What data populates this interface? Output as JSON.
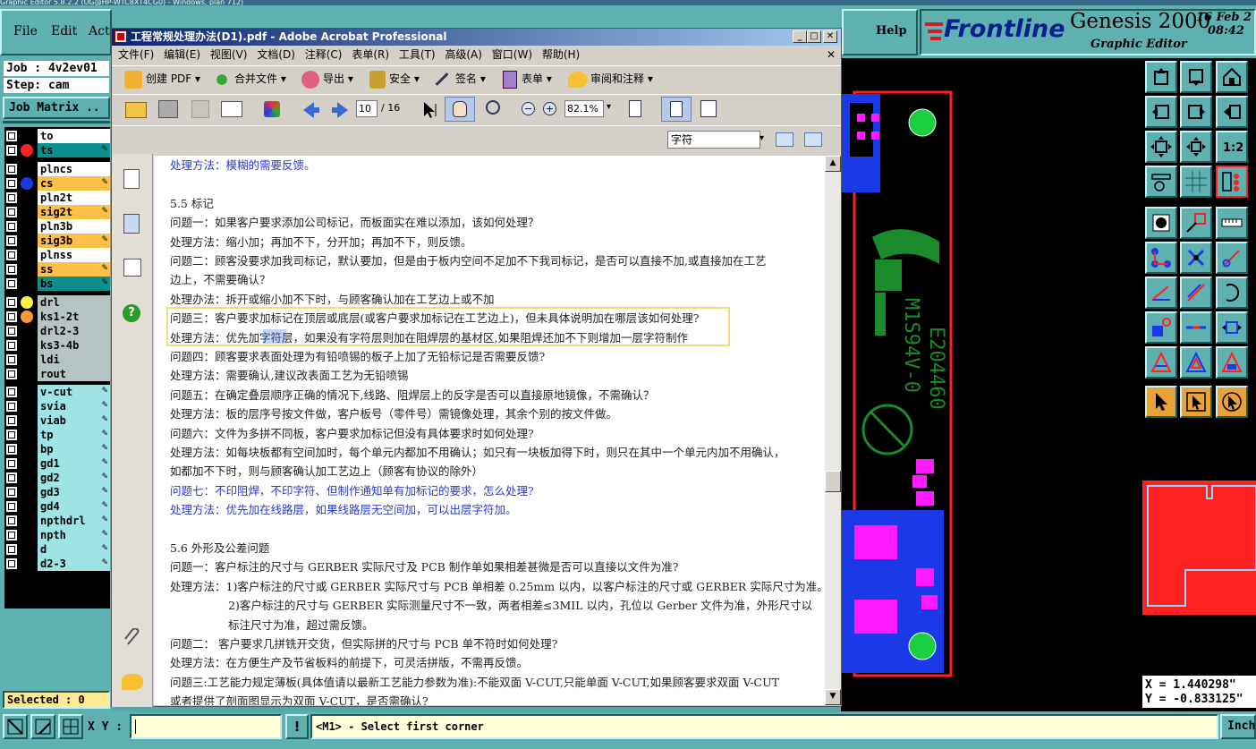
{
  "genesis": {
    "title_strip": "Graphic Editor 5.8.2.2 (UG@HP-WTC8XT4CG0) - Windows, plan 712)",
    "menu": [
      "File",
      "Edit",
      "Act"
    ],
    "help": "Help",
    "brand": "Frontline",
    "product": "Genesis 2000",
    "subtitle": "Graphic Editor",
    "date": "16 Feb 2",
    "time": "08:42",
    "job": "Job : 4v2ev01",
    "step": "Step: cam",
    "job_matrix": "Job Matrix ..",
    "selected": "Selected : 0",
    "xy_label": "X Y :",
    "prompt": "<M1> - Select first corner",
    "units": "Inch",
    "coord_x": "X = 1.440298\"",
    "coord_y": "Y = -0.833125\"",
    "board_text_1": "E204460",
    "board_text_2": "M1S94V-0",
    "colors": {
      "panel": "#5fb0b0",
      "dark": "#1f5a5a",
      "orange": "#e8a23a",
      "board_red": "#ff2020",
      "board_green": "#1a8a2a",
      "pad_magenta": "#ff1aff",
      "copper_blue": "#1a3ae8"
    }
  },
  "layers": [
    {
      "name": "to",
      "dot": "",
      "style": "plain",
      "edit": false
    },
    {
      "name": "ts",
      "dot": "#ff2020",
      "style": "teal",
      "edit": true
    },
    {
      "name": "plncs",
      "dot": "",
      "style": "plain",
      "edit": false
    },
    {
      "name": "cs",
      "dot": "#1a3ae8",
      "style": "orange",
      "edit": true
    },
    {
      "name": "pln2t",
      "dot": "",
      "style": "plain",
      "edit": false
    },
    {
      "name": "sig2t",
      "dot": "",
      "style": "orange",
      "edit": true
    },
    {
      "name": "pln3b",
      "dot": "",
      "style": "plain",
      "edit": false
    },
    {
      "name": "sig3b",
      "dot": "",
      "style": "orange",
      "edit": true
    },
    {
      "name": "plnss",
      "dot": "",
      "style": "plain",
      "edit": false
    },
    {
      "name": "ss",
      "dot": "",
      "style": "orange",
      "edit": true
    },
    {
      "name": "bs",
      "dot": "",
      "style": "teal",
      "edit": true
    },
    {
      "name": "drl",
      "dot": "#ffee44",
      "style": "grey",
      "edit": false
    },
    {
      "name": "ks1-2t",
      "dot": "#ff9933",
      "style": "grey",
      "edit": false
    },
    {
      "name": "drl2-3",
      "dot": "",
      "style": "grey",
      "edit": false
    },
    {
      "name": "ks3-4b",
      "dot": "",
      "style": "grey",
      "edit": false
    },
    {
      "name": "ldi",
      "dot": "",
      "style": "grey",
      "edit": false
    },
    {
      "name": "rout",
      "dot": "",
      "style": "grey",
      "edit": false
    },
    {
      "name": "v-cut",
      "dot": "",
      "style": "cyan",
      "edit": true
    },
    {
      "name": "svia",
      "dot": "",
      "style": "cyan",
      "edit": true
    },
    {
      "name": "viab",
      "dot": "",
      "style": "cyan",
      "edit": true
    },
    {
      "name": "tp",
      "dot": "",
      "style": "cyan",
      "edit": true
    },
    {
      "name": "bp",
      "dot": "",
      "style": "cyan",
      "edit": true
    },
    {
      "name": "gd1",
      "dot": "",
      "style": "cyan",
      "edit": true
    },
    {
      "name": "gd2",
      "dot": "",
      "style": "cyan",
      "edit": true
    },
    {
      "name": "gd3",
      "dot": "",
      "style": "cyan",
      "edit": true
    },
    {
      "name": "gd4",
      "dot": "",
      "style": "cyan",
      "edit": true
    },
    {
      "name": "npthdrl",
      "dot": "",
      "style": "cyan",
      "edit": true
    },
    {
      "name": "npth",
      "dot": "",
      "style": "cyan",
      "edit": true
    },
    {
      "name": "d",
      "dot": "",
      "style": "cyan",
      "edit": true
    },
    {
      "name": "d2-3",
      "dot": "",
      "style": "cyan",
      "edit": true
    }
  ],
  "acrobat": {
    "title": "工程常规处理办法(D1).pdf - Adobe Acrobat Professional",
    "menu": [
      "文件(F)",
      "编辑(E)",
      "视图(V)",
      "文档(D)",
      "注释(C)",
      "表单(R)",
      "工具(T)",
      "高级(A)",
      "窗口(W)",
      "帮助(H)"
    ],
    "toolbar1": {
      "create_pdf": "创建 PDF",
      "merge": "合并文件",
      "export": "导出",
      "security": "安全",
      "sign": "签名",
      "forms": "表单",
      "review": "审阅和注释"
    },
    "page_current": "10",
    "page_total": "/ 16",
    "zoom": "82.1%",
    "search_value": "字符",
    "lines": [
      {
        "text": "处理方法：模糊的需要反馈。",
        "cls": "blue"
      },
      {
        "text": "",
        "cls": ""
      },
      {
        "text": "5.5 标记",
        "cls": ""
      },
      {
        "text": "问题一：如果客户要求添加公司标记，而板面实在难以添加，该如何处理？",
        "cls": ""
      },
      {
        "text": "处理方法：缩小加；再加不下，分开加；再加不下，则反馈。",
        "cls": ""
      },
      {
        "text": "问题二：顾客没要求加我司标记，默认要加，但是由于板内空间不足加不下我司标记，是否可以直接不加,或直接加在工艺",
        "cls": ""
      },
      {
        "text": "边上，不需要确认？",
        "cls": ""
      },
      {
        "text": "处理办法：拆开或缩小加不下时，与顾客确认加在工艺边上或不加",
        "cls": ""
      },
      {
        "text": "问题三：客户要求加标记在顶层或底层(或客户要求加标记在工艺边上)，但未具体说明加在哪层该如何处理?",
        "cls": "hl1"
      },
      {
        "text": "处理方法：优先加字符层，如果没有字符层则加在阻焊层的基材区,如果阻焊还加不下则增加一层字符制作",
        "cls": "hl2"
      },
      {
        "text": "问题四：顾客要求表面处理为有铅喷锡的板子上加了无铅标记是否需要反馈?",
        "cls": ""
      },
      {
        "text": "处理方法：需要确认,建议改表面工艺为无铅喷锡",
        "cls": ""
      },
      {
        "text": "问题五：在确定叠层顺序正确的情况下,线路、阻焊层上的反字是否可以直接原地镜像，不需确认？",
        "cls": ""
      },
      {
        "text": "处理方法：板的层序号按文件做，客户板号（零件号）需镜像处理，其余个别的按文件做。",
        "cls": ""
      },
      {
        "text": "问题六：文件为多拼不同板，客户要求加标记但没有具体要求时如何处理?",
        "cls": ""
      },
      {
        "text": "处理方法：如每块板都有空间加时，每个单元内都加不用确认；如只有一块板加得下时，则只在其中一个单元内加不用确认，",
        "cls": ""
      },
      {
        "text": "如都加不下时，则与顾客确认加工艺边上（顾客有协议的除外）",
        "cls": ""
      },
      {
        "text": "问题七：不印阻焊，不印字符、但制作通知单有加标记的要求，怎么处理?",
        "cls": "blue"
      },
      {
        "text": "处理方法：优先加在线路层，如果线路层无空间加，可以出层字符加。",
        "cls": "blue"
      },
      {
        "text": "",
        "cls": ""
      },
      {
        "text": "5.6 外形及公差问题",
        "cls": ""
      },
      {
        "text": "问题一：客户标注的尺寸与 GERBER 实际尺寸及 PCB 制作单如果相差甚微是否可以直接以文件为准?",
        "cls": ""
      },
      {
        "text": "处理方法：1)客户标注的尺寸或 GERBER 实际尺寸与 PCB 单相差 0.25mm 以内，以客户标注的尺寸或 GERBER 实际尺寸为准。",
        "cls": ""
      },
      {
        "text": "2)客户标注的尺寸与 GERBER 实际测量尺寸不一致，两者相差≤3MIL 以内，孔位以 Gerber 文件为准，外形尺寸以",
        "cls": "indent"
      },
      {
        "text": "标注尺寸为准，超过需反馈。",
        "cls": "indent"
      },
      {
        "text": "问题二：  客户要求几拼铣开交货，但实际拼的尺寸与 PCB 单不符时如何处理?",
        "cls": ""
      },
      {
        "text": "处理方法：在方便生产及节省板料的前提下，可灵活拼版，不需再反馈。",
        "cls": ""
      },
      {
        "text": "问题三:工艺能力规定薄板(具体值请以最新工艺能力参数为准):不能双面 V-CUT,只能单面 V-CUT,如果顾客要求双面 V-CUT",
        "cls": ""
      },
      {
        "text": "或者提供了剖面图显示为双面 V-CUT，是否需确认?",
        "cls": ""
      }
    ]
  }
}
